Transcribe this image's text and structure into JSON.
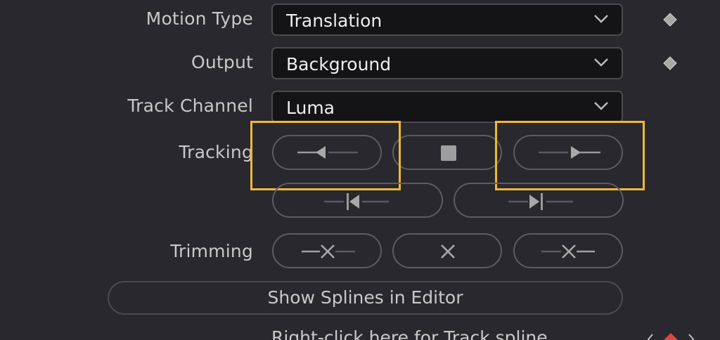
{
  "rows": {
    "motion_type": {
      "label": "Motion Type",
      "value": "Translation"
    },
    "output": {
      "label": "Output",
      "value": "Background"
    },
    "track_channel": {
      "label": "Track Channel",
      "value": "Luma"
    }
  },
  "tracking": {
    "label": "Tracking"
  },
  "trimming": {
    "label": "Trimming"
  },
  "show_splines_button": "Show Splines in Editor",
  "footer_text": "Right-click here for Track spline",
  "icons": {
    "dropdown": "chevron-down-icon",
    "keyframe": "keyframe-diamond-icon",
    "track_reverse": "track-reverse-icon",
    "stop": "stop-icon",
    "track_forward": "track-forward-icon",
    "track_reverse_from_end": "track-reverse-from-end-icon",
    "track_forward_from_start": "track-forward-from-start-icon",
    "trim_before": "trim-before-icon",
    "trim_all": "close-icon",
    "trim_after": "trim-after-icon"
  },
  "colors": {
    "background": "#28282e",
    "field_background": "#141416",
    "highlight": "#efb833",
    "keyframe_active": "#e0463a"
  }
}
